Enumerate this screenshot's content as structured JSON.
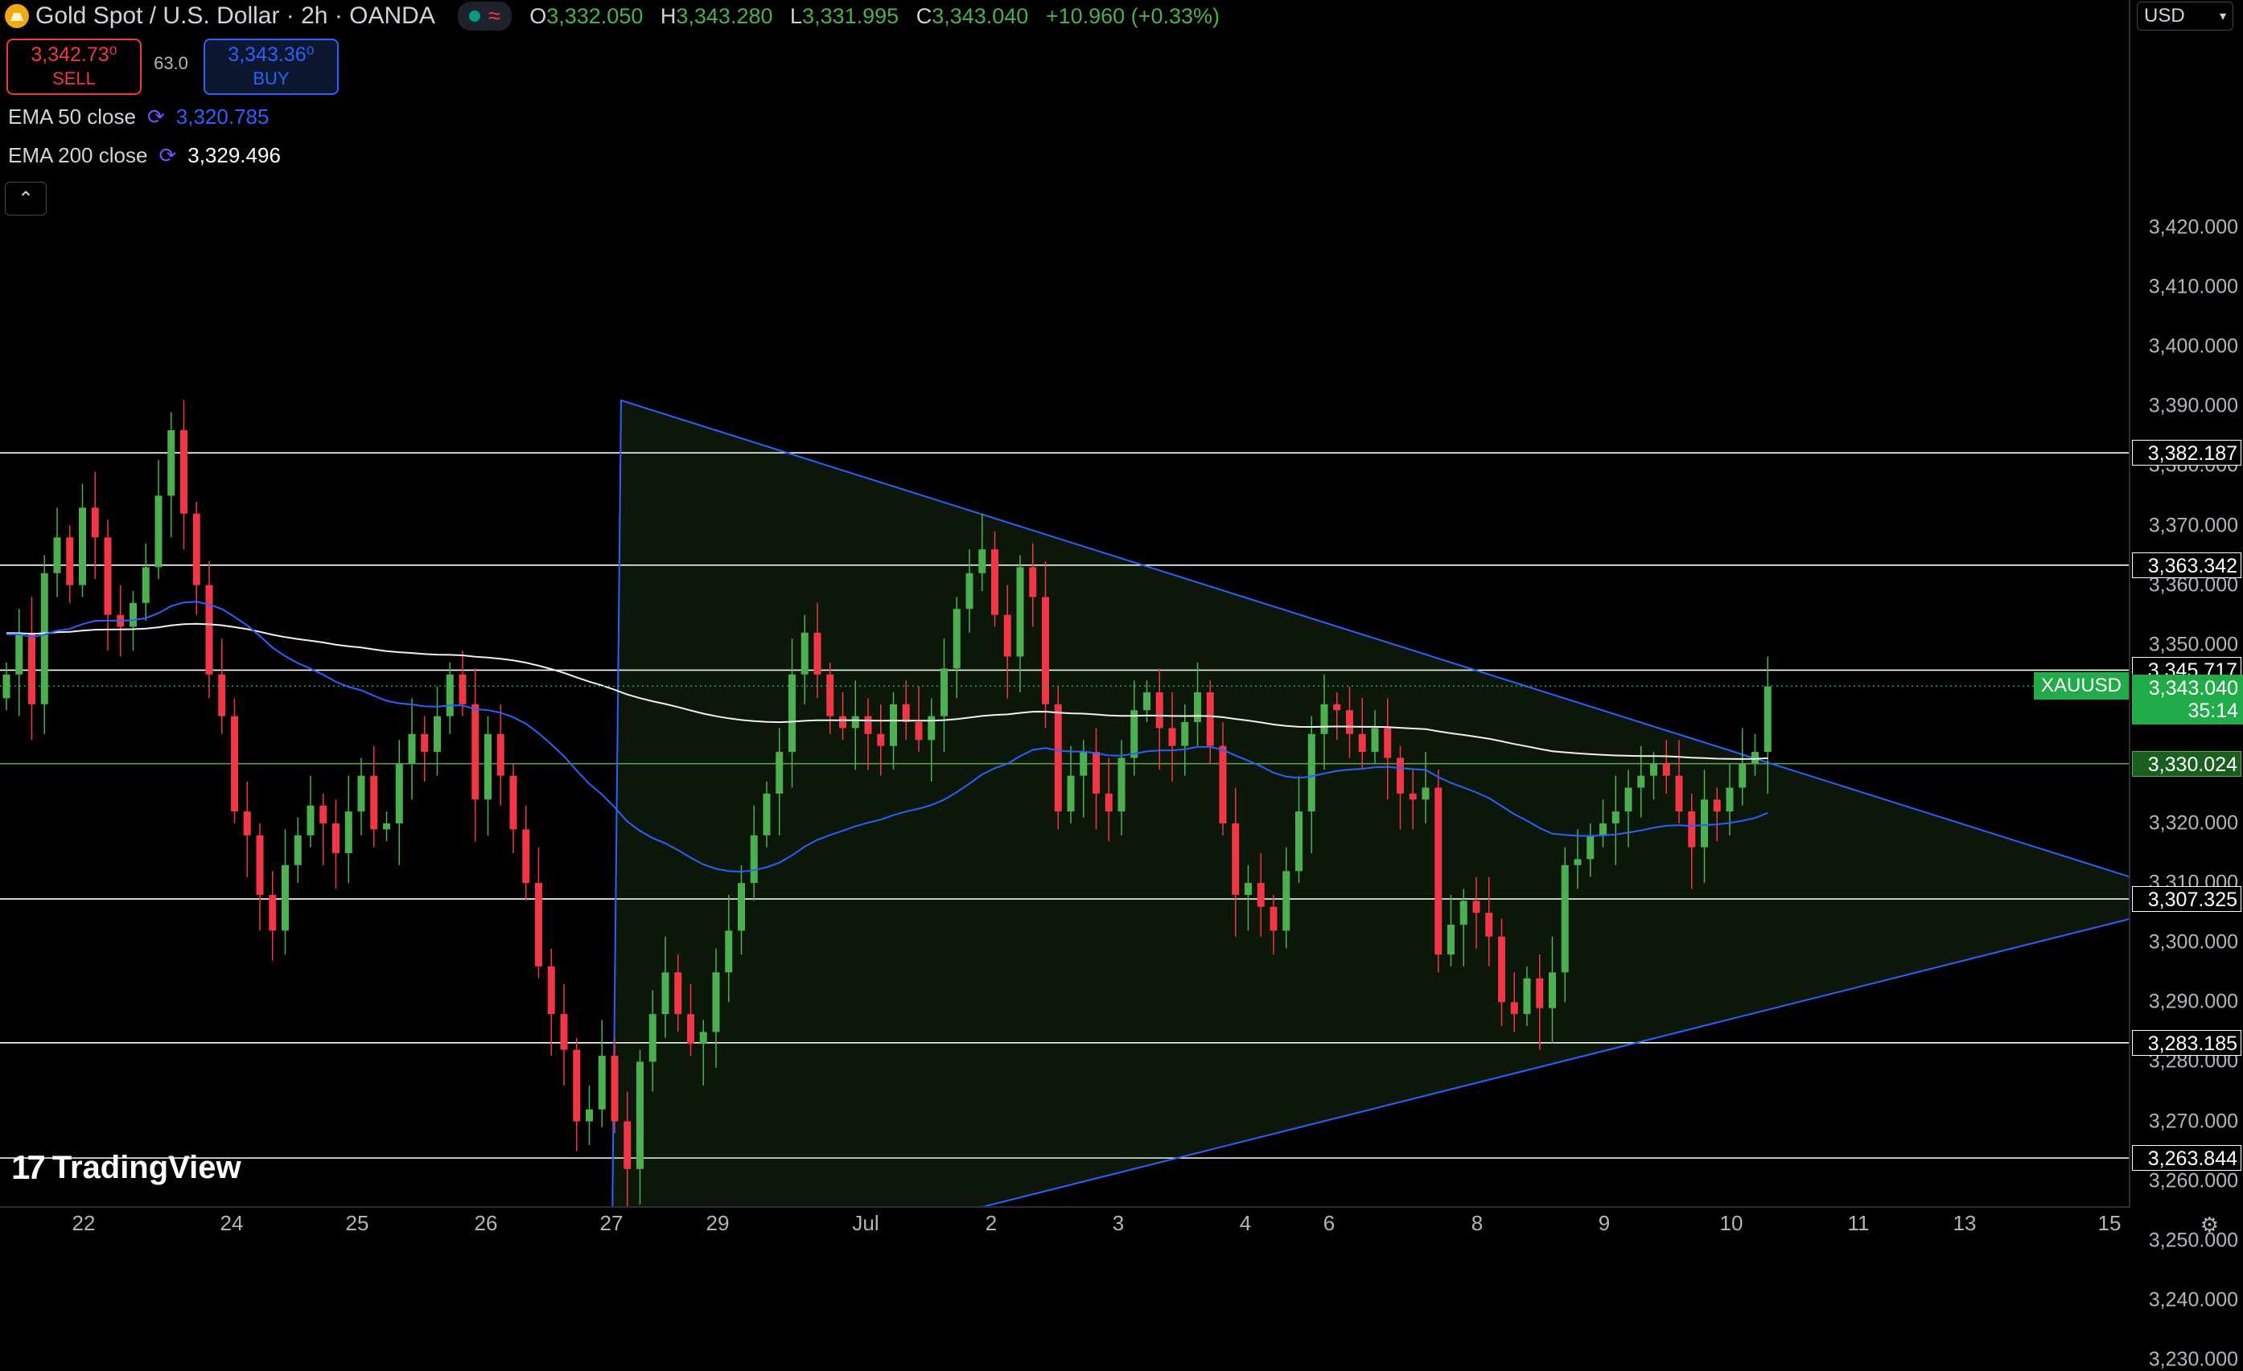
{
  "header": {
    "title": "Gold Spot / U.S. Dollar · 2h · OANDA",
    "ohlc": {
      "o_label": "O",
      "o": "3,332.050",
      "h_label": "H",
      "h": "3,343.280",
      "l_label": "L",
      "l": "3,331.995",
      "c_label": "C",
      "c": "3,343.040",
      "change": "+10.960 (+0.33%)"
    }
  },
  "trade": {
    "sell_price": "3,342.73⁰",
    "sell_label": "SELL",
    "spread": "63.0",
    "buy_price": "3,343.36⁰",
    "buy_label": "BUY"
  },
  "indicators": [
    {
      "name": "EMA 50 close",
      "value": "3,320.785",
      "color": "#2962ff"
    },
    {
      "name": "EMA 200 close",
      "value": "3,329.496",
      "color": "#ffffff"
    }
  ],
  "currency": "USD",
  "branding": "TradingView",
  "price_axis": [
    "3,420.000",
    "3,410.000",
    "3,400.000",
    "3,390.000",
    "3,380.000",
    "3,370.000",
    "3,360.000",
    "3,350.000",
    "3,340.000",
    "3,330.000",
    "3,320.000",
    "3,310.000",
    "3,300.000",
    "3,290.000",
    "3,280.000",
    "3,270.000",
    "3,260.000",
    "3,250.000",
    "3,240.000",
    "3,230.000"
  ],
  "horizontal_lines": [
    "3,382.187",
    "3,363.342",
    "3,345.717",
    "3,330.024",
    "3,307.325",
    "3,283.185",
    "3,263.844"
  ],
  "current_price": {
    "symbol": "XAUUSD",
    "price": "3,343.040",
    "countdown": "35:14"
  },
  "time_axis": [
    "22",
    "24",
    "25",
    "26",
    "27",
    "29",
    "Jul",
    "2",
    "3",
    "4",
    "6",
    "8",
    "9",
    "10",
    "11",
    "13",
    "15"
  ],
  "chart_data": {
    "type": "candlestick",
    "symbol": "XAUUSD",
    "timeframe": "2h",
    "ylim": [
      3225,
      3425
    ],
    "colors": {
      "up": "#4caf50",
      "down": "#f23645",
      "ema50": "#2962ff",
      "ema200": "#ffffff",
      "pattern": "#2962ff"
    },
    "pattern": {
      "type": "triangle",
      "points": [
        [
          3391,
          "Jun 27"
        ],
        [
          3240,
          "Jun 27"
        ],
        [
          3310,
          "Jul 15"
        ],
        [
          3305,
          "Jul 15"
        ]
      ]
    },
    "closes": [
      3345,
      3352,
      3340,
      3362,
      3368,
      3360,
      3373,
      3368,
      3355,
      3353,
      3357,
      3363,
      3375,
      3386,
      3372,
      3360,
      3345,
      3338,
      3322,
      3318,
      3308,
      3302,
      3313,
      3318,
      3323,
      3320,
      3315,
      3322,
      3328,
      3319,
      3320,
      3330,
      3335,
      3332,
      3338,
      3345,
      3340,
      3324,
      3335,
      3328,
      3319,
      3310,
      3296,
      3288,
      3282,
      3270,
      3272,
      3281,
      3270,
      3262,
      3280,
      3288,
      3295,
      3288,
      3283,
      3285,
      3295,
      3302,
      3310,
      3318,
      3325,
      3332,
      3345,
      3352,
      3345,
      3338,
      3336,
      3338,
      3335,
      3333,
      3340,
      3337,
      3334,
      3338,
      3346,
      3356,
      3362,
      3366,
      3355,
      3348,
      3363,
      3358,
      3340,
      3322,
      3328,
      3332,
      3325,
      3322,
      3331,
      3339,
      3342,
      3336,
      3333,
      3337,
      3342,
      3333,
      3320,
      3308,
      3310,
      3306,
      3302,
      3312,
      3322,
      3335,
      3340,
      3339,
      3335,
      3332,
      3336,
      3331,
      3325,
      3324,
      3326,
      3298,
      3303,
      3307,
      3305,
      3301,
      3290,
      3288,
      3294,
      3289,
      3295,
      3313,
      3314,
      3318,
      3320,
      3322,
      3326,
      3328,
      3330,
      3328,
      3322,
      3316,
      3324,
      3322,
      3326,
      3330,
      3332,
      3343
    ]
  }
}
